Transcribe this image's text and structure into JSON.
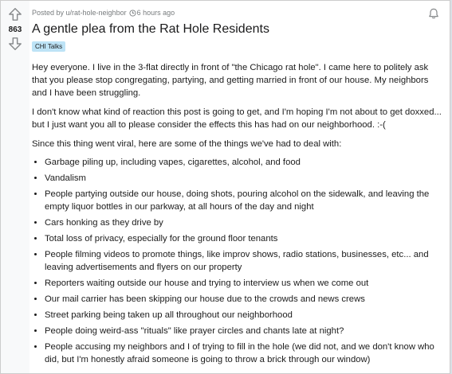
{
  "post": {
    "score": "863",
    "posted_by": "Posted by u/rat-hole-neighbor",
    "time_ago": "6 hours ago",
    "title": "A gentle plea from the Rat Hole Residents",
    "flair": "CHI Talks",
    "paragraphs": [
      "Hey everyone. I live in the 3-flat directly in front of \"the Chicago rat hole\". I came here to politely ask that you please stop congregating, partying, and getting married in front of our house. My neighbors and I have been struggling.",
      "I don't know what kind of reaction this post is going to get, and I'm hoping I'm not about to get doxxed... but I just want you all to please consider the effects this has had on our neighborhood. :-(",
      "Since this thing went viral, here are some of the things we've had to deal with:"
    ],
    "bullets": [
      "Garbage piling up, including vapes, cigarettes, alcohol, and food",
      "Vandalism",
      "People partying outside our house, doing shots, pouring alcohol on the sidewalk, and leaving the empty liquor bottles in our parkway, at all hours of the day and night",
      "Cars honking as they drive by",
      "Total loss of privacy, especially for the ground floor tenants",
      "People filming videos to promote things, like improv shows, radio stations, businesses, etc... and leaving advertisements and flyers on our property",
      "Reporters waiting outside our house and trying to interview us when we come out",
      "Our mail carrier has been skipping our house due to the crowds and news crews",
      "Street parking being taken up all throughout our neighborhood",
      "People doing weird-ass \"rituals\" like prayer circles and chants late at night?",
      "People accusing my neighbors and I of trying to fill in the hole (we did not, and we don't know who did, but I'm honestly afraid someone is going to throw a brick through our window)"
    ]
  },
  "icons": {
    "upvote": "upvote-arrow-icon",
    "downvote": "downvote-arrow-icon",
    "time": "clock-icon",
    "notify": "bell-icon"
  },
  "colors": {
    "flair_bg": "#bde3f6",
    "meta_text": "#787c7e"
  }
}
